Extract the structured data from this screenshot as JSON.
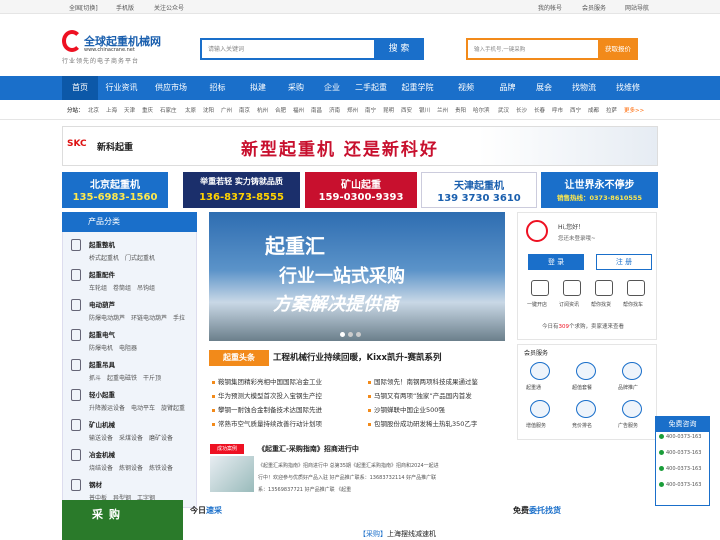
{
  "topbar": {
    "region_prefix": "全国",
    "region_switch": "[切换]",
    "mobile": "手机版",
    "wechat": "关注公众号",
    "my_account": "我的帐号",
    "member_service": "会员服务",
    "site_nav": "网站导航"
  },
  "header": {
    "logo_text": "全球起重机械网",
    "logo_url": "www.chinacrane.net",
    "logo_slogan": "行业领先的电子商务平台",
    "search_placeholder": "请输入关键词",
    "search_button": "搜 索",
    "quote_placeholder": "输入手机号,一键采购",
    "quote_button": "获取报价"
  },
  "nav": {
    "items": [
      "首页",
      "行业资讯",
      "供应市场",
      "招标",
      "拟建",
      "采购",
      "企业",
      "二手起重",
      "起重学院",
      "视频",
      "品牌",
      "展会",
      "找物流",
      "找维修"
    ]
  },
  "subnav": {
    "label": "分站：",
    "cities": [
      "北京",
      "上海",
      "天津",
      "重庆",
      "石家庄",
      "太原",
      "沈阳",
      "广州",
      "南京",
      "杭州",
      "合肥",
      "福州",
      "南昌",
      "济南",
      "郑州",
      "南宁",
      "昆明",
      "西安",
      "银川",
      "兰州",
      "贵阳",
      "哈尔滨",
      "武汉",
      "长沙",
      "长春",
      "呼市",
      "西宁",
      "成都",
      "拉萨"
    ],
    "more": "更多>>"
  },
  "banners": {
    "top_brand": "新科起重",
    "top_logo": "SKC",
    "top_slogan": "新型起重机 还是新科好",
    "ads": [
      {
        "l1": "北京起重机",
        "l2": "135-6983-1560"
      },
      {
        "l1": "举重若轻 实力铸就品质",
        "l2": "136-8373-8555"
      },
      {
        "l1": "矿山起重",
        "l2": "159-0300-9393"
      },
      {
        "l1": "天津起重机",
        "l2": "139 3730 3610"
      },
      {
        "l1": "让世界永不停步",
        "l2": "销售热线：0373-8610555"
      }
    ]
  },
  "categories": {
    "title": "产品分类",
    "groups": [
      {
        "name": "起重整机",
        "items": [
          "桥式起重机",
          "门式起重机"
        ]
      },
      {
        "name": "起重配件",
        "items": [
          "车轮组",
          "卷筒组",
          "吊钩组"
        ]
      },
      {
        "name": "电动葫芦",
        "items": [
          "防爆电动葫芦",
          "环链电动葫芦",
          "手拉"
        ]
      },
      {
        "name": "起重电气",
        "items": [
          "防爆电机",
          "电阻器"
        ]
      },
      {
        "name": "起重吊具",
        "items": [
          "抓斗",
          "起重电磁铁",
          "干斤顶"
        ]
      },
      {
        "name": "轻小起重",
        "items": [
          "升降搬运设备",
          "电动平车",
          "旋臂起重"
        ]
      },
      {
        "name": "矿山机械",
        "items": [
          "输送设备",
          "采煤设备",
          "磨矿设备"
        ]
      },
      {
        "name": "冶金机械",
        "items": [
          "烧结设备",
          "炼钢设备",
          "炼铁设备"
        ]
      },
      {
        "name": "钢材",
        "items": [
          "普中板",
          "异型钢",
          "工字钢"
        ]
      }
    ]
  },
  "slider": {
    "line1": "起重汇",
    "line2": "行业一站式采购",
    "line3": "方案解决提供商"
  },
  "headline": {
    "tag": "起重头条",
    "title": "工程机械行业持续回暖，Kixx凯升-赛凯系列"
  },
  "news": [
    "鞍钢集团精彩亮相中国国际冶金工业",
    "国际领先！南钢两项科技成果通过鉴",
    "华为预测大模型首次投入宝钢生产控",
    "马钢又有两项“独家”产品国内首发",
    "攀钢一耐蚀合金制备技术达国际先进",
    "沙钢蝉联中国企业500强",
    "常熟市空气质量持续改善行动计划项",
    "包钢股份成功研发稀土热轧350乙字"
  ],
  "case": {
    "tag": "成功案例",
    "title": "《起重汇-采购指南》招商进行中",
    "lines": [
      "《起重汇采购指南》招商进行中     总第35期《起重汇采购指南》招商和2024一起进",
      "行中！欢迎参与优质好产品入驻      好产品推广联系：13683732114      好产品推广联",
      "系：13569837721      好产品推广联      《起重"
    ]
  },
  "user": {
    "greeting": "Hi,您好！",
    "welcome": "您还未登录哦~",
    "login": "登 录",
    "register": "注 册",
    "quick": [
      "一键开店",
      "订阅资讯",
      "帮你找货",
      "帮你找车"
    ],
    "stats_prefix": "今日有",
    "stats_count": "309",
    "stats_suffix": "个求购，卖家速来查看"
  },
  "services": {
    "title": "会员服务",
    "items": [
      "起重通",
      "超值套餐",
      "品牌推广",
      "增值服务",
      "竞价排名",
      "广告服务"
    ]
  },
  "hotline": {
    "title": "免费咨询",
    "tels": [
      "400-0373-163",
      "400-0373-163",
      "400-0373-163",
      "400-0373-163"
    ]
  },
  "bottom": {
    "buy_title": "采购",
    "today_prefix": "今日",
    "today_hl": "速采",
    "buy_tag": "【采购】",
    "buy_item": "上海摆线减速机",
    "find_prefix": "免费",
    "find_hl": "委托找货"
  },
  "colors": {
    "brand_blue": "#1a6fca",
    "accent_orange": "#f28a1a",
    "red": "#e12"
  }
}
